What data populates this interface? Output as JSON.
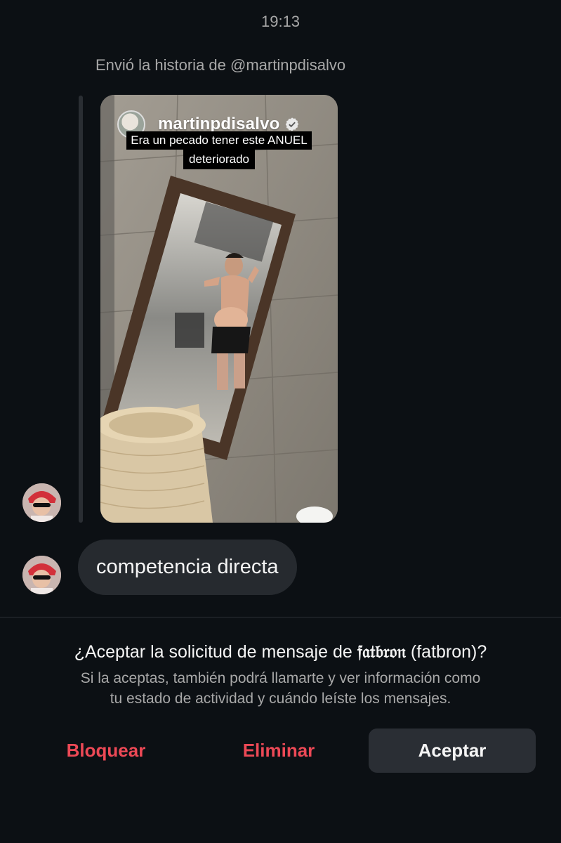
{
  "header": {
    "time": "19:13"
  },
  "story": {
    "label": "Envió la historia de @martinpdisalvo",
    "username": "martinpdisalvo",
    "caption_line1": "Era un pecado tener este ANUEL",
    "caption_line2": "deteriorado"
  },
  "message": {
    "text": "competencia directa"
  },
  "request": {
    "title_prefix": "¿Aceptar la solicitud de mensaje de",
    "display_name": "𝔣𝔞𝔱𝔟𝔯𝔬𝔫",
    "title_suffix": "(fatbron)?",
    "desc_line1": "Si la aceptas, también podrá llamarte y ver información como",
    "desc_line2": "tu estado de actividad y cuándo leíste los mensajes."
  },
  "actions": {
    "block": "Bloquear",
    "delete": "Eliminar",
    "accept": "Aceptar"
  },
  "colors": {
    "background": "#0c1014",
    "danger": "#ed4956",
    "bubble": "#262a2f",
    "secondary_text": "#a8a8a8"
  }
}
